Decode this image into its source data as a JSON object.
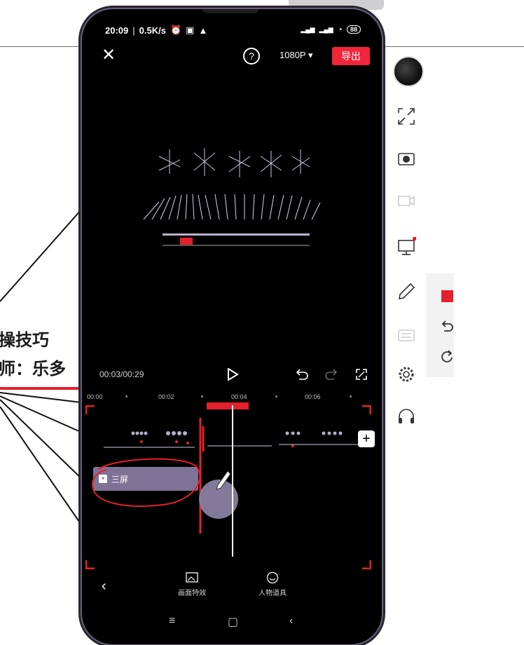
{
  "background_slide": {
    "line1": "操技巧",
    "line2": "师：乐多"
  },
  "status_bar": {
    "time": "20:09",
    "speed": "0.5K/s",
    "signal_label": "4G",
    "battery": "88"
  },
  "top_bar": {
    "resolution": "1080P",
    "export_label": "导出"
  },
  "playback": {
    "time_display": "00:03/00:29"
  },
  "ruler": {
    "ticks": [
      "00:00",
      "00:02",
      "00:04",
      "00:06"
    ]
  },
  "timeline": {
    "effect_clip_label": "三屏",
    "add_label": "+"
  },
  "bottom_tools": {
    "tool1": "画面特效",
    "tool2": "人物道具"
  },
  "colors": {
    "accent": "#f2253a",
    "clip": "#7e7397",
    "annotation": "#e3202b"
  }
}
